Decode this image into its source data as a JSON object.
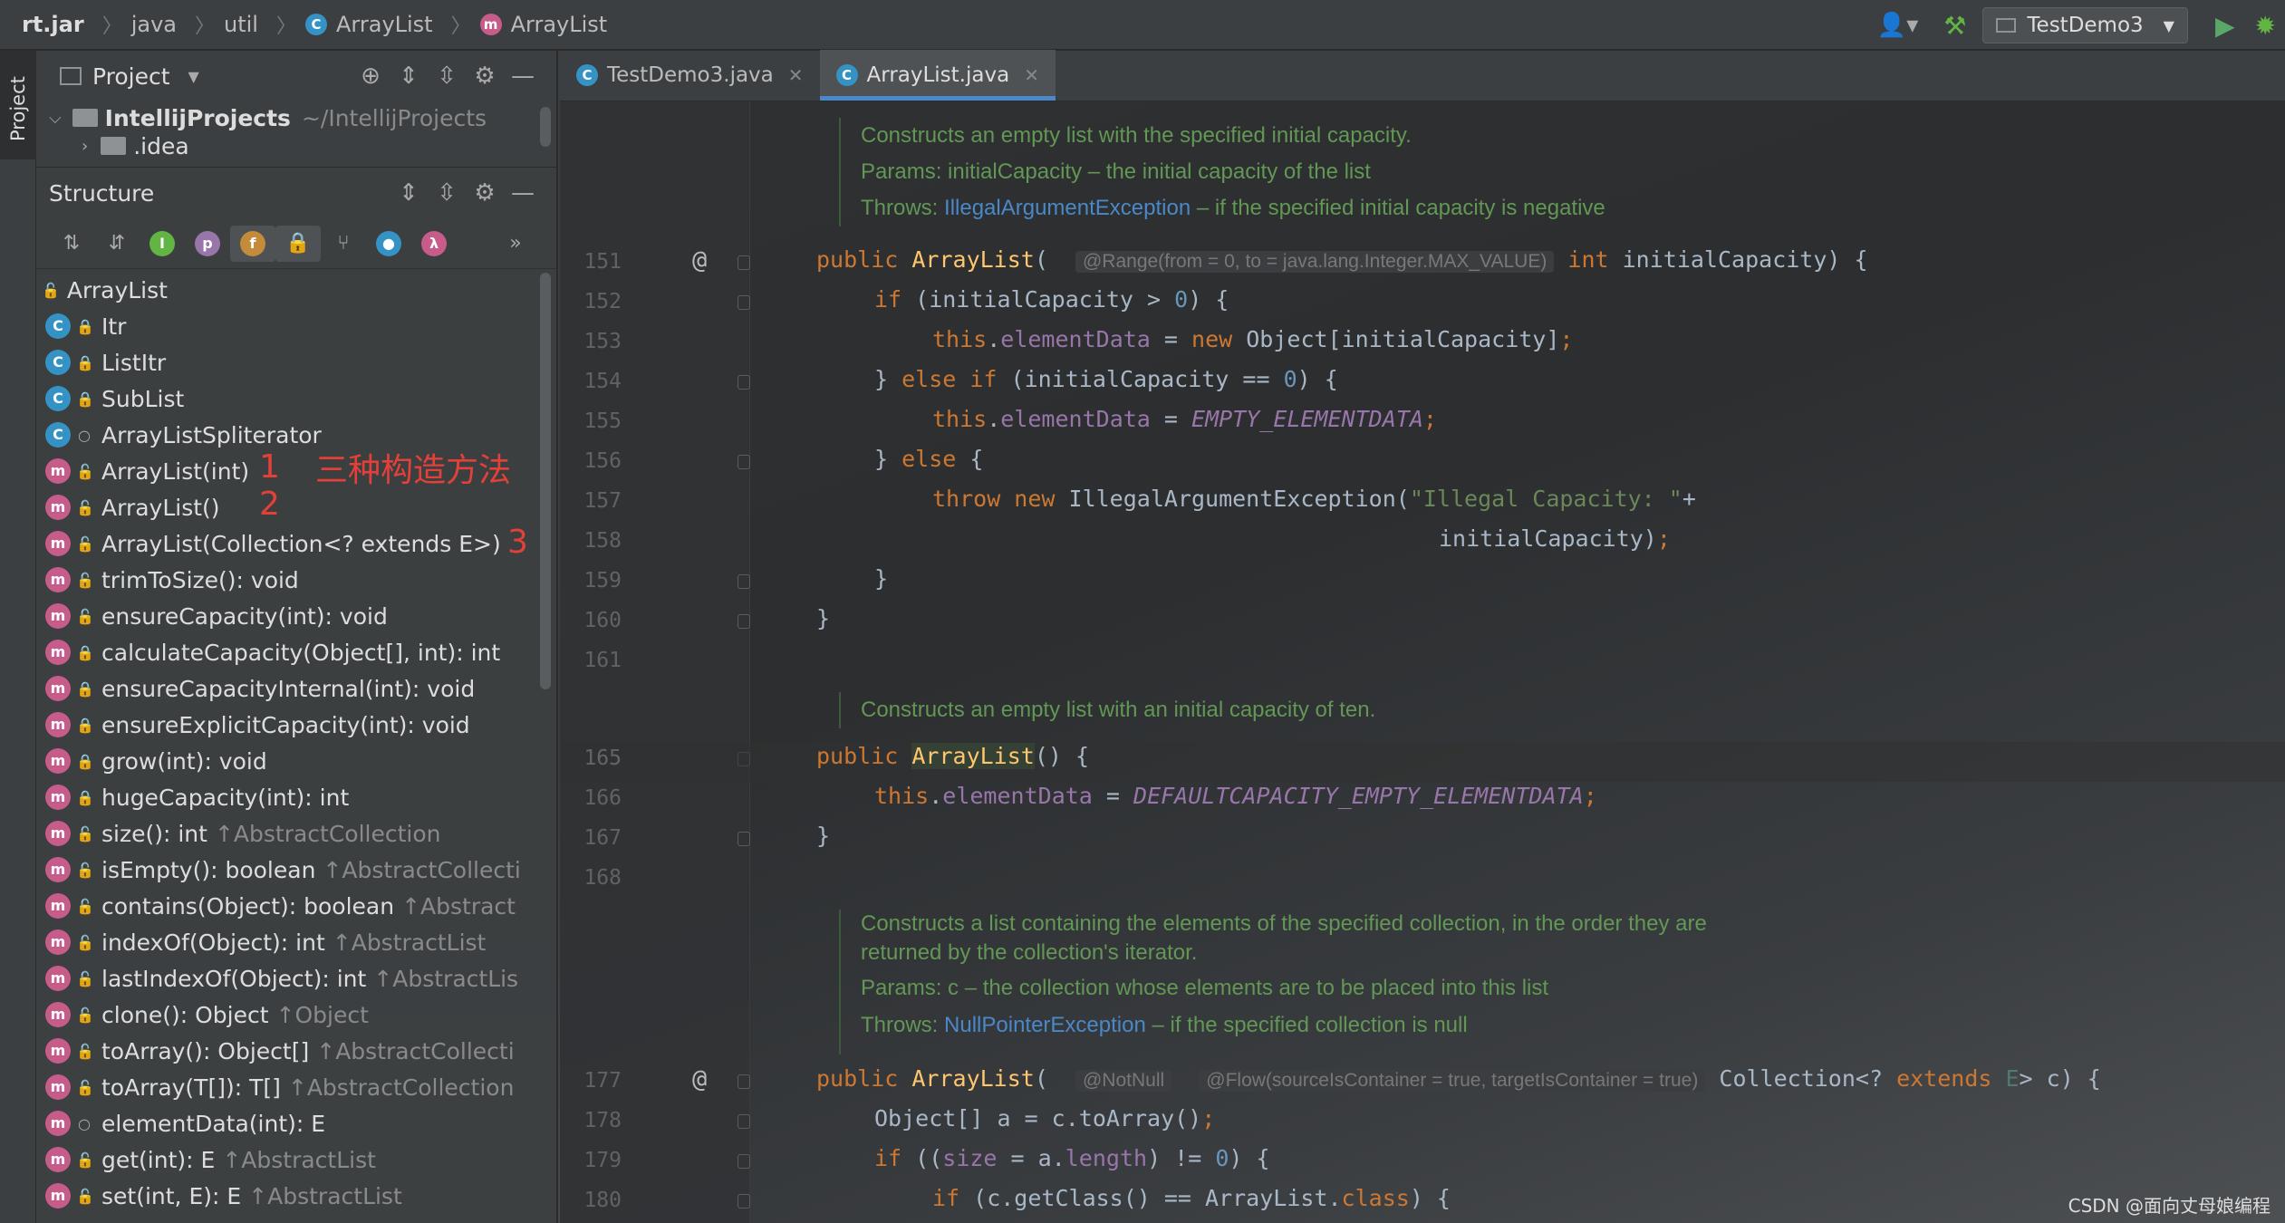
{
  "breadcrumb": {
    "items": [
      "rt.jar",
      "java",
      "util",
      "ArrayList",
      "ArrayList"
    ]
  },
  "toolbar": {
    "run_config": "TestDemo3"
  },
  "side_strip": {
    "label": "Project"
  },
  "project_panel": {
    "title": "Project",
    "tree": [
      {
        "name": "IntellijProjects",
        "path": "~/IntellijProjects"
      },
      {
        "name": ".idea"
      }
    ]
  },
  "structure_panel": {
    "title": "Structure",
    "filter_icons": [
      "sort-by-visibility-icon",
      "sort-alphabetically-icon",
      "show-inherited-icon",
      "show-properties-icon",
      "show-fields-icon",
      "show-non-public-icon",
      "show-lambdas-branch-icon",
      "autoscroll-icon",
      "lambda-icon",
      "more-icon"
    ],
    "root": "ArrayList",
    "items": [
      {
        "kind": "class",
        "vis": "private",
        "name": "Itr",
        "inherited": ""
      },
      {
        "kind": "class",
        "vis": "private",
        "name": "ListItr",
        "inherited": ""
      },
      {
        "kind": "class",
        "vis": "private",
        "name": "SubList",
        "inherited": ""
      },
      {
        "kind": "class",
        "vis": "package",
        "name": "ArrayListSpliterator",
        "inherited": ""
      },
      {
        "kind": "method",
        "vis": "public",
        "name": "ArrayList(int)",
        "inherited": ""
      },
      {
        "kind": "method",
        "vis": "public",
        "name": "ArrayList()",
        "inherited": ""
      },
      {
        "kind": "method",
        "vis": "public",
        "name": "ArrayList(Collection<? extends E>)",
        "inherited": ""
      },
      {
        "kind": "method",
        "vis": "public",
        "name": "trimToSize(): void",
        "inherited": ""
      },
      {
        "kind": "method",
        "vis": "public",
        "name": "ensureCapacity(int): void",
        "inherited": ""
      },
      {
        "kind": "method",
        "vis": "private",
        "name": "calculateCapacity(Object[], int): int",
        "inherited": ""
      },
      {
        "kind": "method",
        "vis": "private",
        "name": "ensureCapacityInternal(int): void",
        "inherited": ""
      },
      {
        "kind": "method",
        "vis": "private",
        "name": "ensureExplicitCapacity(int): void",
        "inherited": ""
      },
      {
        "kind": "method",
        "vis": "private",
        "name": "grow(int): void",
        "inherited": ""
      },
      {
        "kind": "method",
        "vis": "private",
        "name": "hugeCapacity(int): int",
        "inherited": ""
      },
      {
        "kind": "method",
        "vis": "public",
        "name": "size(): int",
        "inherited": "↑AbstractCollection"
      },
      {
        "kind": "method",
        "vis": "public",
        "name": "isEmpty(): boolean",
        "inherited": "↑AbstractCollecti"
      },
      {
        "kind": "method",
        "vis": "public",
        "name": "contains(Object): boolean",
        "inherited": "↑Abstract"
      },
      {
        "kind": "method",
        "vis": "public",
        "name": "indexOf(Object): int",
        "inherited": "↑AbstractList"
      },
      {
        "kind": "method",
        "vis": "public",
        "name": "lastIndexOf(Object): int",
        "inherited": "↑AbstractLis"
      },
      {
        "kind": "method",
        "vis": "public",
        "name": "clone(): Object",
        "inherited": "↑Object"
      },
      {
        "kind": "method",
        "vis": "public",
        "name": "toArray(): Object[]",
        "inherited": "↑AbstractCollecti"
      },
      {
        "kind": "method",
        "vis": "public",
        "name": "toArray(T[]): T[]",
        "inherited": "↑AbstractCollection"
      },
      {
        "kind": "method",
        "vis": "package",
        "name": "elementData(int): E",
        "inherited": ""
      },
      {
        "kind": "method",
        "vis": "public",
        "name": "get(int): E",
        "inherited": "↑AbstractList"
      },
      {
        "kind": "method",
        "vis": "public",
        "name": "set(int, E): E",
        "inherited": "↑AbstractList"
      }
    ],
    "annotations": {
      "one": "1",
      "title": "三种构造方法",
      "two": "2",
      "three": "3"
    }
  },
  "tabs": [
    {
      "label": "TestDemo3.java",
      "icon": "C",
      "active": false
    },
    {
      "label": "ArrayList.java",
      "icon": "C",
      "active": true
    }
  ],
  "editor": {
    "doc1": {
      "line1": "Constructs an empty list with the specified initial capacity.",
      "line2": "Params: initialCapacity – the initial capacity of the list",
      "throws_label": "Throws:",
      "throws_link": "IllegalArgumentException",
      "throws_rest": " – if the specified initial capacity is negative"
    },
    "doc2": {
      "line1": "Constructs an empty list with an initial capacity of ten."
    },
    "doc3": {
      "line1": "Constructs a list containing the elements of the specified collection, in the order they are",
      "line1b": "returned by the collection's iterator.",
      "line2": "Params: c – the collection whose elements are to be placed into this list",
      "throws_label": "Throws:",
      "throws_link": "NullPointerException",
      "throws_rest": " – if the specified collection is null"
    },
    "line_numbers": [
      "151",
      "152",
      "153",
      "154",
      "155",
      "156",
      "157",
      "158",
      "159",
      "160",
      "161",
      "165",
      "166",
      "167",
      "168",
      "177",
      "178",
      "179",
      "180"
    ],
    "hints": {
      "range": "@Range(from = 0, to = java.lang.Integer.MAX_VALUE)",
      "notnull": "@NotNull",
      "flow": "@Flow(sourceIsContainer = true, targetIsContainer = true)"
    },
    "strings": {
      "illegal": "\"Illegal Capacity: \""
    },
    "watermark": "CSDN @面向丈母娘编程"
  }
}
